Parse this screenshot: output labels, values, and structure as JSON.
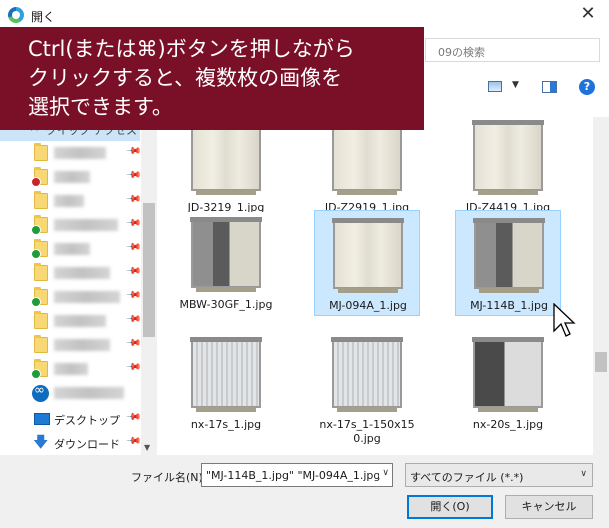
{
  "window": {
    "title": "開く"
  },
  "search": {
    "placeholder": "09の検索"
  },
  "overlay": {
    "lines": [
      "Ctrl(または⌘)ボタンを押しながら",
      "クリックすると、複数枚の画像を",
      "選択できます。"
    ]
  },
  "nav": {
    "quick_access_label": "クイック アクセス",
    "items": [
      {
        "icon": "folder-icon",
        "badge": null
      },
      {
        "icon": "folder-icon",
        "badge": "error"
      },
      {
        "icon": "folder-icon",
        "badge": null
      },
      {
        "icon": "folder-icon",
        "badge": "synced"
      },
      {
        "icon": "folder-icon",
        "badge": "synced"
      },
      {
        "icon": "folder-icon",
        "badge": null
      },
      {
        "icon": "folder-icon",
        "badge": "synced"
      },
      {
        "icon": "folder-icon",
        "badge": null
      },
      {
        "icon": "folder-icon",
        "badge": null
      },
      {
        "icon": "folder-icon",
        "badge": "synced"
      },
      {
        "icon": "onedrive-icon",
        "badge": null
      }
    ],
    "desktop_label": "デスクトップ",
    "downloads_label": "ダウンロード"
  },
  "files": [
    {
      "name": "JD-3219_1.jpg",
      "selected": false,
      "style": "closed"
    },
    {
      "name": "JD-Z2919_1.jpg",
      "selected": false,
      "style": "closed"
    },
    {
      "name": "JD-Z4419_1.jpg",
      "selected": false,
      "style": "closed"
    },
    {
      "name": "MBW-30GF_1.jpg",
      "selected": false,
      "style": "open"
    },
    {
      "name": "MJ-094A_1.jpg",
      "selected": true,
      "style": "closed"
    },
    {
      "name": "MJ-114B_1.jpg",
      "selected": true,
      "style": "open"
    },
    {
      "name": "nx-17s_1.jpg",
      "selected": false,
      "style": "silver"
    },
    {
      "name": "nx-17s_1-150x15",
      "name2": "0.jpg",
      "selected": false,
      "style": "silver"
    },
    {
      "name": "nx-20s_1.jpg",
      "selected": false,
      "style": "dark"
    }
  ],
  "bottom": {
    "filename_label": "ファイル名(N):",
    "filename_value": "\"MJ-114B_1.jpg\" \"MJ-094A_1.jpg\"",
    "filetype_value": "すべてのファイル (*.*)",
    "open_button": "開く(O)",
    "cancel_button": "キャンセル"
  },
  "colors": {
    "overlay_bg": "#7a1027",
    "selection_bg": "#cce8ff",
    "accent": "#0078d7"
  }
}
